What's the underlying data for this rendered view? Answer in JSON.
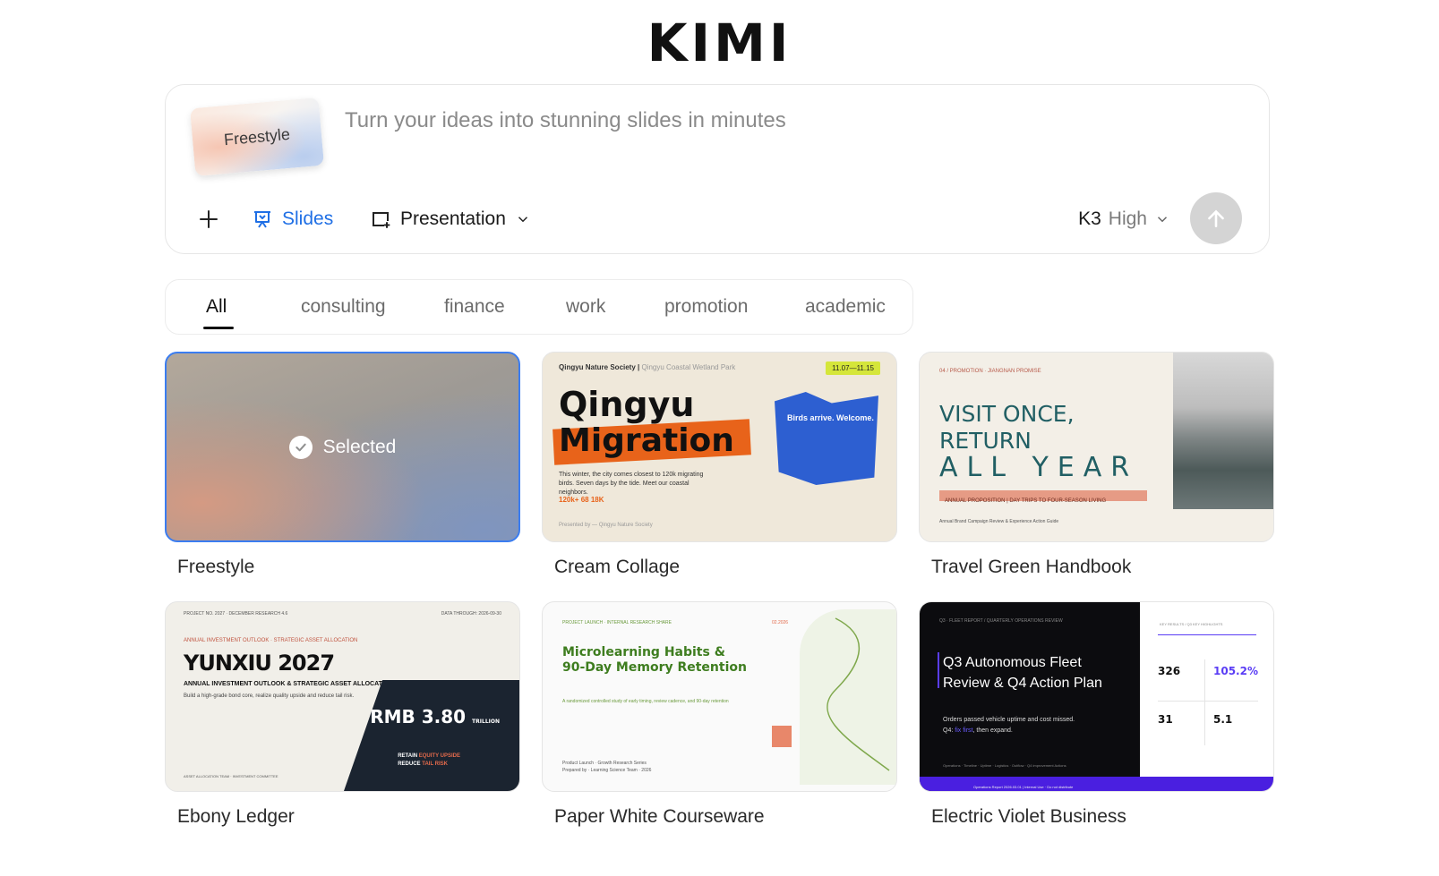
{
  "brand": {
    "logo": "KIMI"
  },
  "composer": {
    "mode_card": "Freestyle",
    "placeholder": "Turn your ideas into stunning slides in minutes",
    "slides_label": "Slides",
    "presentation_label": "Presentation",
    "model_name": "K3",
    "model_level": "High",
    "accent_color": "#1f6fe5"
  },
  "filters": {
    "tabs": [
      {
        "label": "All",
        "active": true
      },
      {
        "label": "consulting"
      },
      {
        "label": "finance"
      },
      {
        "label": "work"
      },
      {
        "label": "promotion"
      },
      {
        "label": "academic"
      }
    ]
  },
  "templates": [
    {
      "name": "Freestyle",
      "selected": true,
      "badge": "Selected"
    },
    {
      "name": "Cream Collage",
      "preview": {
        "org": "Qingyu Nature Society",
        "place": "Qingyu Coastal Wetland Park",
        "date": "11.07—11.15",
        "title_1": "Qingyu",
        "title_2": "Migration",
        "callout": "Birds arrive. Welcome.",
        "text": "This winter, the city comes closest to 120k migrating birds. Seven days by the tide. Meet our coastal neighbors.",
        "stats": "120k+   68   18K",
        "footer": "Presented by — Qingyu Nature Society"
      }
    },
    {
      "name": "Travel Green Handbook",
      "preview": {
        "eyebrow": "04 / PROMOTION · JIANGNAN PROMISE",
        "line1": "VISIT ONCE,",
        "line2": "RETURN",
        "line3": "ALL YEAR",
        "band": "ANNUAL PROPOSITION | DAY TRIPS TO FOUR-SEASON LIVING",
        "footer": "Annual Brand Campaign Review & Experience Action Guide"
      }
    },
    {
      "name": "Ebony Ledger",
      "preview": {
        "project": "PROJECT NO. 2027 · DECEMBER RESEARCH 4.6",
        "data_through": "DATA THROUGH: 2026-09-30",
        "eyebrow": "ANNUAL INVESTMENT OUTLOOK · STRATEGIC ASSET ALLOCATION",
        "title": "YUNXIU 2027",
        "subtitle": "ANNUAL INVESTMENT OUTLOOK & STRATEGIC ASSET ALLOCATION",
        "desc": "Build a high-grade bond core, realize quality upside and reduce tail risk.",
        "amount": "RMB 3.80",
        "unit": "TRILLION",
        "retain_1": "RETAIN",
        "retain_highlight_1": "EQUITY UPSIDE",
        "retain_2": "REDUCE",
        "retain_highlight_2": "TAIL RISK",
        "footer": "ASSET ALLOCATION TEAM · INVESTMENT COMMITTEE"
      }
    },
    {
      "name": "Paper White Courseware",
      "preview": {
        "eyebrow": "PROJECT LAUNCH · INTERNAL RESEARCH SHARE",
        "date": "02.2026",
        "title_1": "Microlearning Habits &",
        "title_2": "90-Day Memory Retention",
        "desc": "A randomized controlled study of early timing, review cadence, and 90-day retention",
        "footer_1": "Product Launch · Growth Research Series",
        "footer_2": "Prepared by · Learning Science Team · 2026"
      }
    },
    {
      "name": "Electric Violet Business",
      "preview": {
        "eyebrow": "Q3 · FLEET REPORT / QUARTERLY OPERATIONS REVIEW",
        "title_1": "Q3 Autonomous Fleet",
        "title_2": "Review & Q4 Action Plan",
        "desc_1": "Orders passed vehicle uptime and cost missed.",
        "desc_2a": "Q4:",
        "desc_2b": "fix first",
        "desc_2c": ", then expand.",
        "footer": "Operations · Timeline · Uptime · Logistics · Outflow · Q4 improvement Actions",
        "band": "Operations Report 2026.03.01 | Internal Use · Do not distribute",
        "right_eyebrow": "KEY RESULTS / Q3 KEY HIGHLIGHTS",
        "stat_1": "326",
        "stat_2": "105.2%",
        "stat_3": "31",
        "stat_4": "5.1",
        "violet": "#5a3df5"
      }
    }
  ]
}
